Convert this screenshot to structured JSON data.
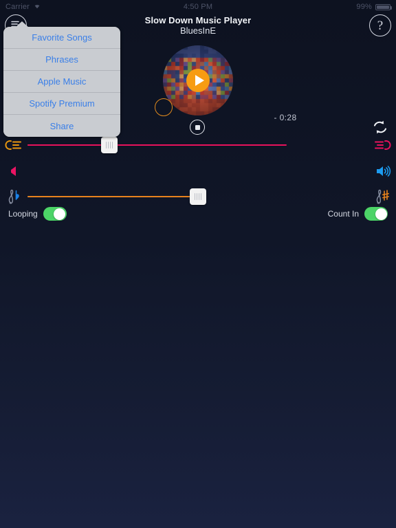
{
  "status_bar": {
    "carrier": "Carrier",
    "wifi_icon": "wifi-icon",
    "time": "4:50 PM",
    "battery_percent": "99%",
    "battery_icon": "battery-full-icon"
  },
  "navbar": {
    "menu_button_icon": "list-add-icon",
    "title": "Slow Down Music Player",
    "subtitle": "BluesInE",
    "help_button_icon": "question-mark-icon",
    "help_label": "?"
  },
  "popover": {
    "visible": true,
    "items": [
      {
        "label": "Favorite Songs",
        "name": "menu-item-favorite-songs"
      },
      {
        "label": "Phrases",
        "name": "menu-item-phrases"
      },
      {
        "label": "Apple Music",
        "name": "menu-item-apple-music"
      },
      {
        "label": "Spotify Premium",
        "name": "menu-item-spotify-premium"
      },
      {
        "label": "Share",
        "name": "menu-item-share"
      }
    ],
    "background": "#c9ccd1",
    "text_color": "#3a7fe8"
  },
  "player": {
    "album_art_icon": "album-art-disc",
    "play_button_icon": "play-icon",
    "play_button_color": "#F79C12",
    "progress_ring_icon": "progress-ring-icon",
    "progress_ring_color": "#E08A1E",
    "stop_button_icon": "stop-icon",
    "time_remaining": "- 0:28",
    "loop_icon": "loop-refresh-icon"
  },
  "speed_slider": {
    "name": "speed-slider",
    "left_icon": "slow-speed-icon",
    "right_icon": "fast-speed-icon",
    "left_color": "#E8960F",
    "right_color": "#E8125C",
    "value_percent": 24
  },
  "volume_row": {
    "name": "volume-control-row",
    "left_icon": "volume-mute-icon",
    "right_icon": "volume-high-icon",
    "left_color": "#EA1463",
    "right_color": "#1C9BF0"
  },
  "pitch_slider": {
    "name": "pitch-slider",
    "left_icon": "clef-flat-icon",
    "right_icon": "clef-sharp-icon",
    "left_color": "#1C83E8",
    "right_color": "#E8821C",
    "value_percent": 50
  },
  "toggles": {
    "looping": {
      "label": "Looping",
      "on": true
    },
    "count_in": {
      "label": "Count In",
      "on": true
    },
    "on_color": "#4CD467"
  },
  "theme": {
    "bg_top": "#0d1220",
    "bg_bottom": "#1a2240",
    "text": "#eceff5"
  }
}
